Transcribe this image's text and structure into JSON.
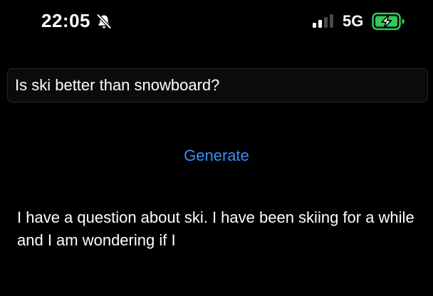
{
  "status_bar": {
    "time": "22:05",
    "network": "5G",
    "icons": [
      "bell-slash-icon",
      "cellular-signal-icon",
      "battery-charging-icon"
    ],
    "battery_color": "#34c759"
  },
  "prompt": {
    "value": "Is ski better than snowboard?"
  },
  "generate": {
    "label": "Generate",
    "color": "#3a8ef6"
  },
  "response": {
    "text": "I have a question about ski. I have been skiing for a while and I am wondering if I"
  }
}
